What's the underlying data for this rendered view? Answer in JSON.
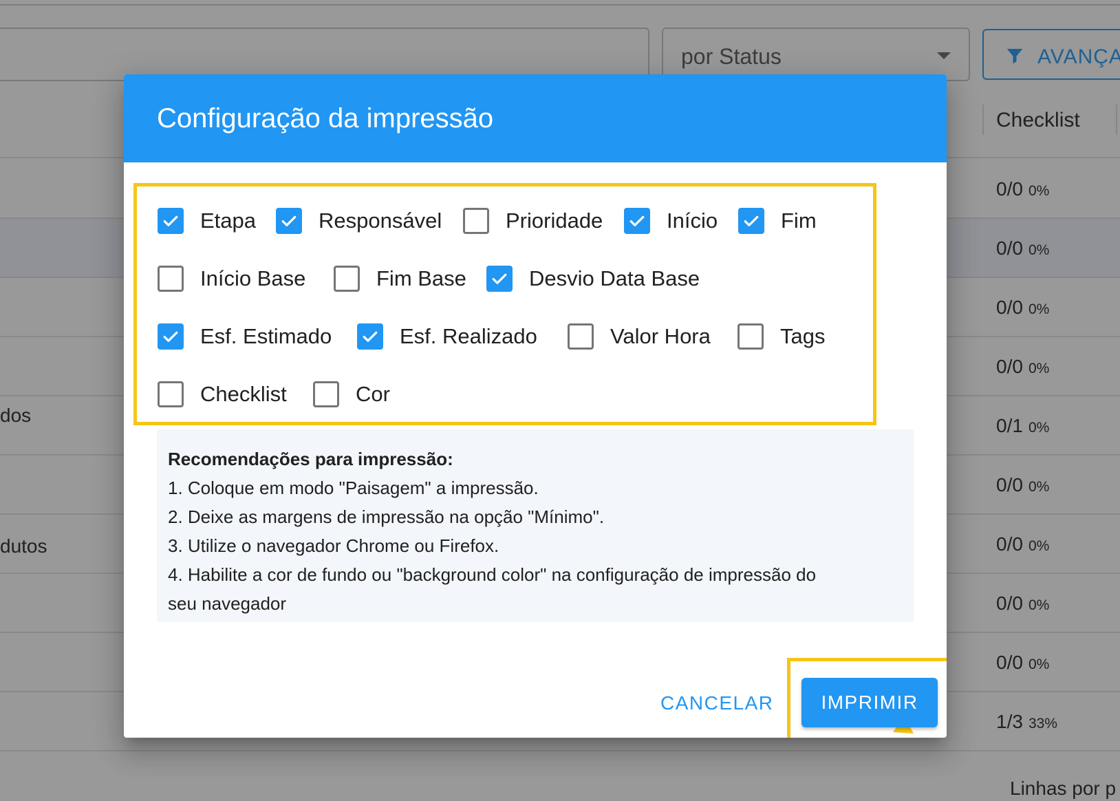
{
  "background": {
    "status_select": "por Status",
    "advanced_button": "AVANÇADO",
    "column_header": "Checklist",
    "checklist_values": [
      {
        "count": "0/0",
        "pct": "0%"
      },
      {
        "count": "0/0",
        "pct": "0%"
      },
      {
        "count": "0/0",
        "pct": "0%"
      },
      {
        "count": "0/0",
        "pct": "0%"
      },
      {
        "count": "0/1",
        "pct": "0%"
      },
      {
        "count": "0/0",
        "pct": "0%"
      },
      {
        "count": "0/0",
        "pct": "0%"
      },
      {
        "count": "0/0",
        "pct": "0%"
      },
      {
        "count": "0/0",
        "pct": "0%"
      },
      {
        "count": "1/3",
        "pct": "33%"
      }
    ],
    "left_texts": [
      "dos",
      "dutos"
    ],
    "footer": "Linhas por p"
  },
  "dialog": {
    "title": "Configuração da impressão",
    "options": [
      {
        "label": "Etapa",
        "checked": true
      },
      {
        "label": "Responsável",
        "checked": true
      },
      {
        "label": "Prioridade",
        "checked": false
      },
      {
        "label": "Início",
        "checked": true
      },
      {
        "label": "Fim",
        "checked": true
      },
      {
        "label": "Início Base",
        "checked": false
      },
      {
        "label": "Fim Base",
        "checked": false
      },
      {
        "label": "Desvio Data Base",
        "checked": true
      },
      {
        "label": "Esf. Estimado",
        "checked": true
      },
      {
        "label": "Esf. Realizado",
        "checked": true
      },
      {
        "label": "Valor Hora",
        "checked": false
      },
      {
        "label": "Tags",
        "checked": false
      },
      {
        "label": "Checklist",
        "checked": false
      },
      {
        "label": "Cor",
        "checked": false
      }
    ],
    "recommendations": {
      "title": "Recomendações para impressão:",
      "lines": [
        "1. Coloque em modo \"Paisagem\" a impressão.",
        "2. Deixe as margens de impressão na opção \"Mínimo\".",
        "3. Utilize o navegador Chrome ou Firefox.",
        "4. Habilite a cor de fundo ou \"background color\" na configuração de impressão do",
        "seu navegador"
      ]
    },
    "cancel_label": "CANCELAR",
    "print_label": "IMPRIMIR"
  },
  "colors": {
    "primary": "#2196f3",
    "highlight_frame": "#f5c518",
    "recommendations_bg": "#f3f6fb"
  }
}
